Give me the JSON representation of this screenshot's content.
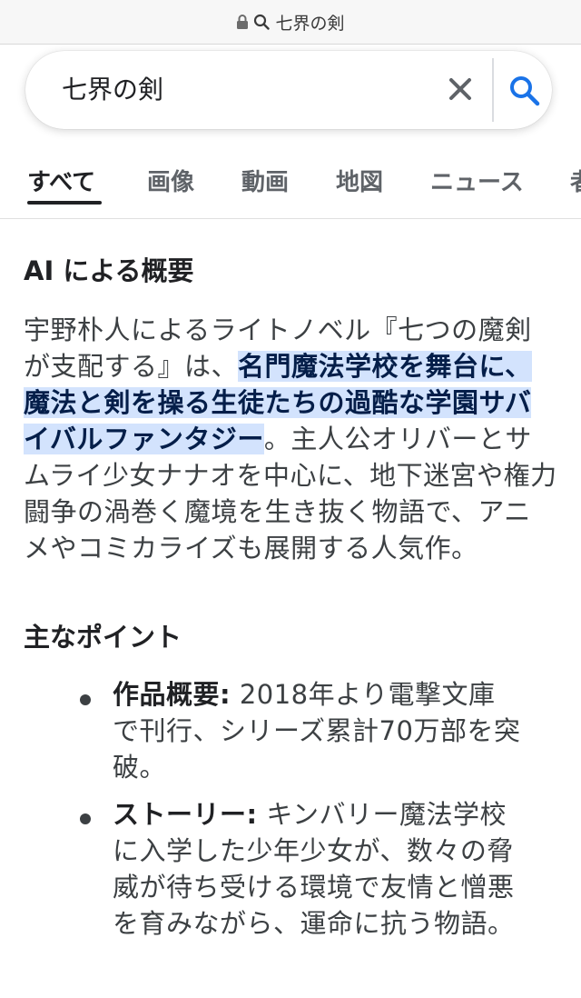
{
  "url_bar": {
    "text": "七界の剣",
    "icons": [
      "lock-icon",
      "search-icon"
    ]
  },
  "search": {
    "query": "七界の剣",
    "icons": [
      "close-icon",
      "search-icon"
    ]
  },
  "tabs": [
    {
      "label": "すべて",
      "active": true
    },
    {
      "label": "画像",
      "active": false
    },
    {
      "label": "動画",
      "active": false
    },
    {
      "label": "地図",
      "active": false
    },
    {
      "label": "ニュース",
      "active": false
    },
    {
      "label": "者",
      "active": false
    }
  ],
  "ai_overview": {
    "heading": "AI による概要",
    "summary_pre": "宇野朴人によるライトノベル『七つの魔剣が支配する』は、",
    "summary_highlight": "名門魔法学校を舞台に、魔法と剣を操る生徒たちの過酷な学園サバイバルファンタジー",
    "summary_post": "。主人公オリバーとサムライ少女ナナオを中心に、地下迷宮や権力闘争の渦巻く魔境を生き抜く物語で、アニメやコミカライズも展開する人気作。",
    "highlight_color": "#d3e3fd"
  },
  "main_points": {
    "heading": "主なポイント",
    "items": [
      {
        "label": "作品概要:",
        "text": " 2018年より電撃文庫で刊行、シリーズ累計70万部を突破。"
      },
      {
        "label": "ストーリー:",
        "text": " キンバリー魔法学校に入学した少年少女が、数々の脅威が待ち受ける環境で友情と憎悪を育みながら、運命に抗う物語。"
      }
    ]
  },
  "colors": {
    "accent_blue": "#1a73e8",
    "text_dark": "#202124",
    "text_gray": "#5f6368"
  }
}
